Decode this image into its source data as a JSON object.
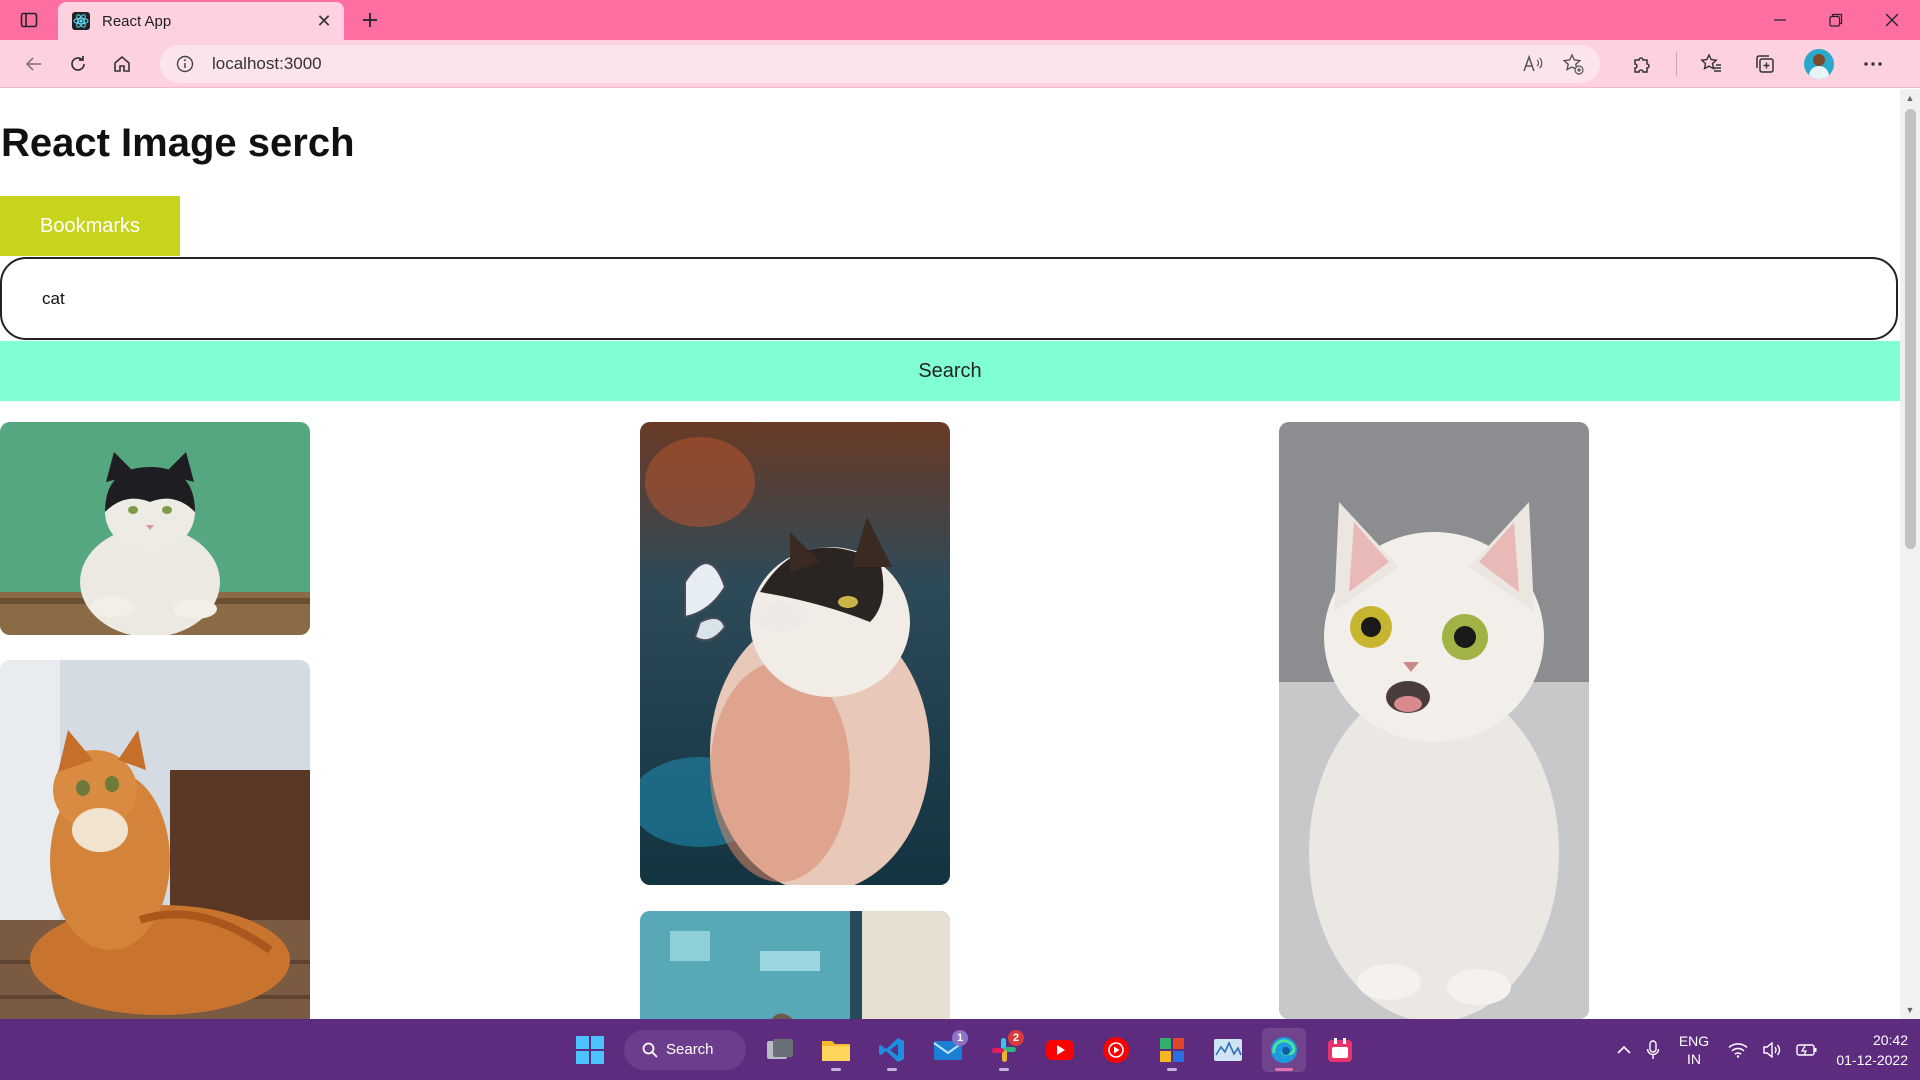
{
  "browser": {
    "tab_title": "React App",
    "address": "localhost:3000"
  },
  "page": {
    "title": "React Image serch",
    "bookmarks_label": "Bookmarks",
    "search_value": "cat",
    "search_button_label": "Search"
  },
  "photos": [
    {
      "alt": "cat photo 1"
    },
    {
      "alt": "cat photo 2"
    },
    {
      "alt": "cat photo 3"
    },
    {
      "alt": "cat photo 4"
    },
    {
      "alt": "cat photo 5"
    }
  ],
  "taskbar": {
    "search_label": "Search",
    "mail_badge": "1",
    "slack_badge": "2",
    "lang_line1": "ENG",
    "lang_line2": "IN",
    "time": "20:42",
    "date": "01-12-2022"
  },
  "colors": {
    "titlebar": "#fc6fa0",
    "bookmarks": "#c8d41b",
    "search_button": "#80ffd4",
    "taskbar": "#5e2c7f"
  }
}
